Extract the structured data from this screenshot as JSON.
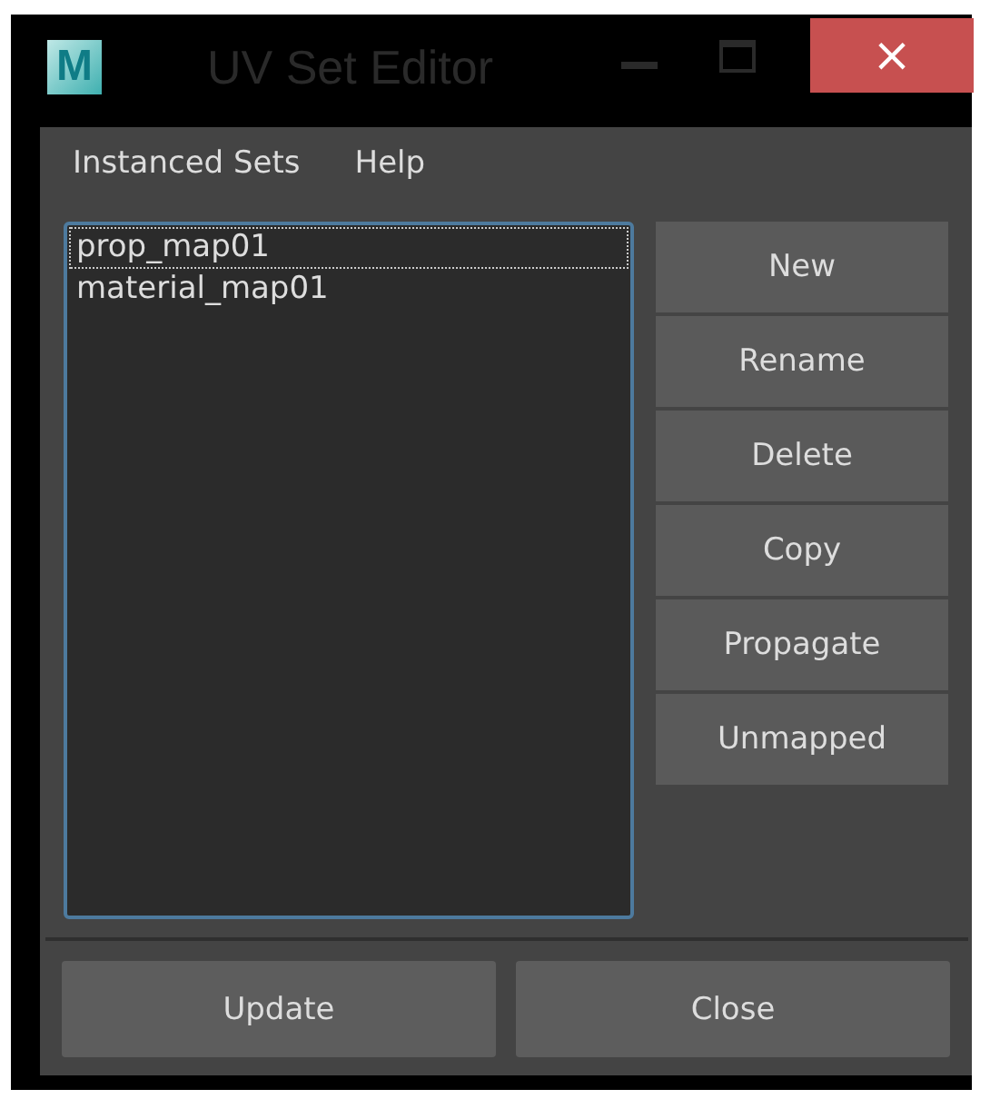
{
  "window": {
    "logo": "M",
    "title": "UV Set Editor",
    "close": "×"
  },
  "menu": [
    "Instanced Sets",
    "Help"
  ],
  "uv_sets": [
    {
      "label": "prop_map01",
      "focused": true
    },
    {
      "label": "material_map01",
      "focused": false
    }
  ],
  "side_buttons": [
    "New",
    "Rename",
    "Delete",
    "Copy",
    "Propagate",
    "Unmapped"
  ],
  "bottom_buttons": [
    "Update",
    "Close"
  ]
}
